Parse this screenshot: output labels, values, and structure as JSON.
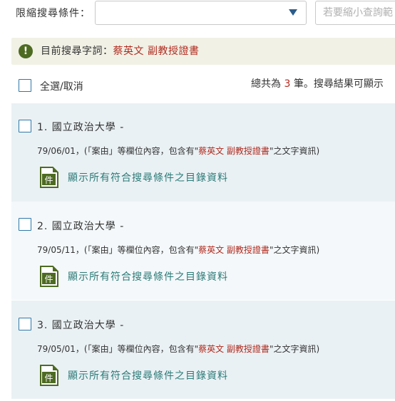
{
  "filter": {
    "label": "限縮搜尋條件：",
    "select_value": "",
    "narrow_placeholder": "若要縮小查詢範"
  },
  "current_search": {
    "label": "目前搜尋字詞：",
    "terms": "蔡英文 副教授證書"
  },
  "select_all": {
    "label": "全選/取消"
  },
  "total": {
    "prefix": "總共為 ",
    "count": "3",
    "suffix": " 筆。搜尋結果可顯示"
  },
  "results": [
    {
      "title": "1. 國立政治大學 -",
      "date": "79/06/01",
      "desc_prefix": "，(「案由」等欄位內容，包含有\"",
      "desc_hl": "蔡英文 副教授證書",
      "desc_suffix": "\"之文字資訊)",
      "link": "顯示所有符合搜尋條件之目錄資料"
    },
    {
      "title": "2. 國立政治大學 -",
      "date": "79/05/11",
      "desc_prefix": "，(「案由」等欄位內容，包含有\"",
      "desc_hl": "蔡英文 副教授證書",
      "desc_suffix": "\"之文字資訊)",
      "link": "顯示所有符合搜尋條件之目錄資料"
    },
    {
      "title": "3. 國立政治大學 -",
      "date": "79/05/01",
      "desc_prefix": "，(「案由」等欄位內容，包含有\"",
      "desc_hl": "蔡英文 副教授證書",
      "desc_suffix": "\"之文字資訊)",
      "link": "顯示所有符合搜尋條件之目錄資料"
    }
  ],
  "icons": {
    "info": "info-icon",
    "document": "document-icon",
    "document_glyph": "件",
    "chevron": "chevron-down-icon"
  },
  "colors": {
    "accent_green": "#4e6b22",
    "highlight_red": "#b12a1e",
    "link_teal": "#2b7a77"
  }
}
